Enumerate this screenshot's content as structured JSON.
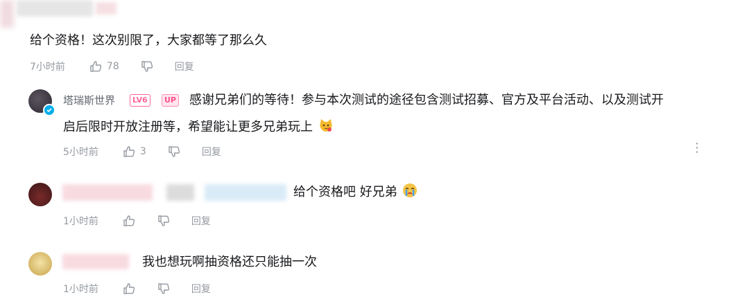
{
  "comments": [
    {
      "text": "给个资格！这次别限了，大家都等了那么久",
      "time": "7小时前",
      "likes": "78",
      "reply_label": "回复",
      "icons": [
        "like-icon",
        "dislike-icon"
      ]
    },
    {
      "username": "塔瑞斯世界",
      "badges": [
        "LV6",
        "UP"
      ],
      "text_line1": "感谢兄弟们的等待！参与本次测试的途径包含测试招募、官方及平台活动、以及测试开",
      "text_line2": "启后限时开放注册等，希望能让更多兄弟玩上",
      "emoji": "cat-emoji",
      "time": "5小时前",
      "likes": "3",
      "reply_label": "回复",
      "menu": "⋮"
    },
    {
      "text": "给个资格吧 好兄弟",
      "emoji": "crying-emoji",
      "time": "1小时前",
      "reply_label": "回复"
    },
    {
      "text": "我也想玩啊抽资格还只能抽一次",
      "time": "1小时前",
      "reply_label": "回复"
    }
  ],
  "colors": {
    "text": "#18191c",
    "meta": "#9499a0",
    "accent_pink": "#ff6699",
    "verified_blue": "#00aeec"
  }
}
